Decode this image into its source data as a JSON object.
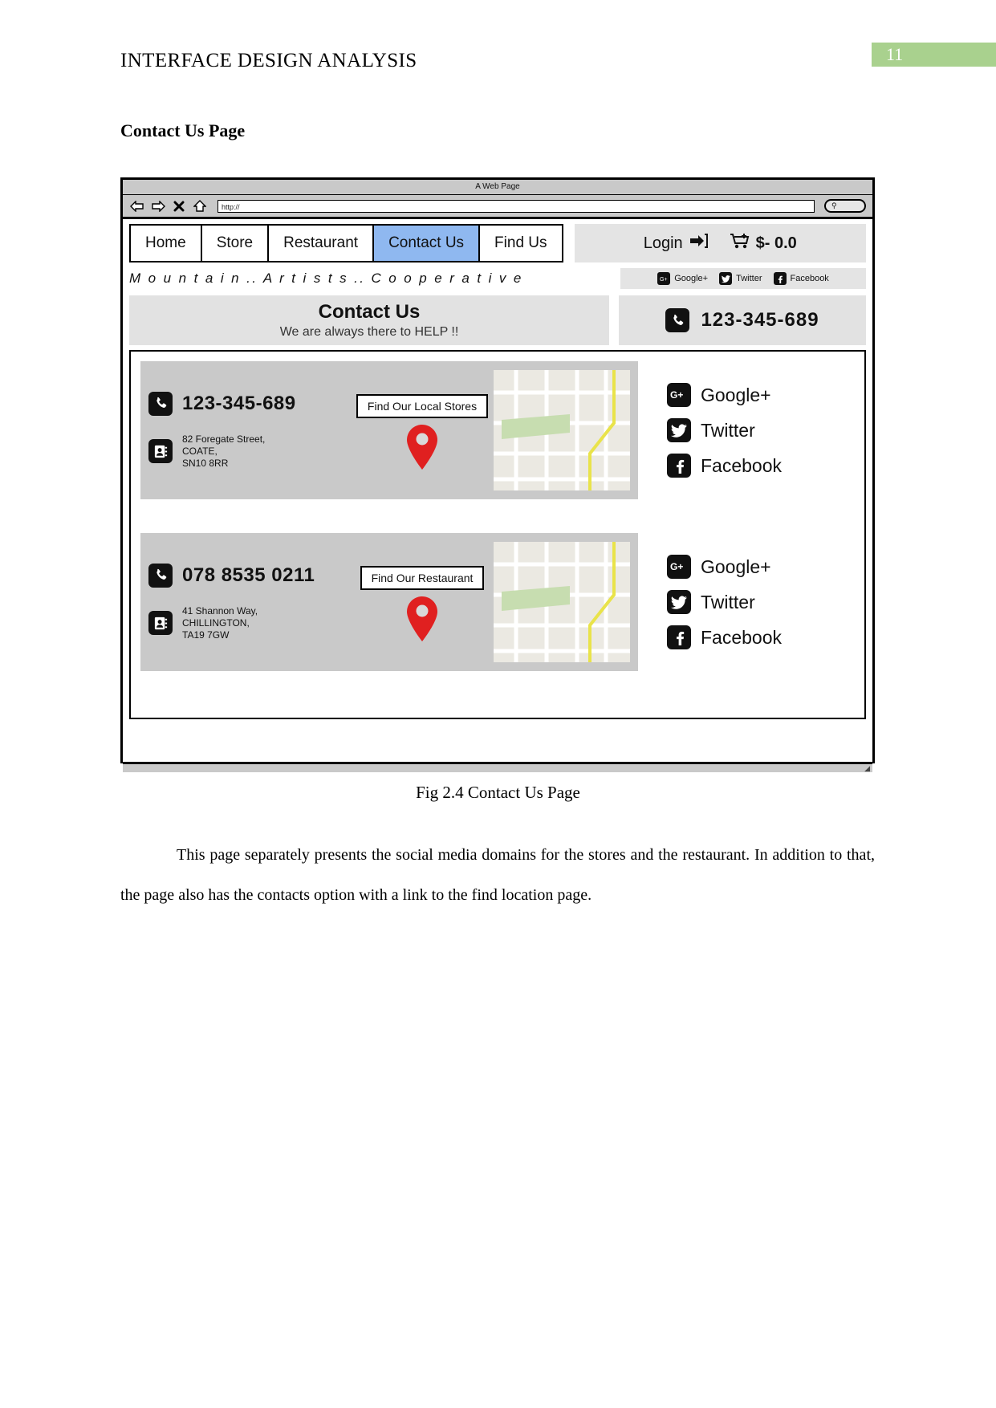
{
  "doc": {
    "header_title": "INTERFACE DESIGN ANALYSIS",
    "page_number": "11",
    "section_heading": "Contact Us Page",
    "figure_caption": "Fig 2.4 Contact Us Page",
    "paragraph": "This page separately presents the social media domains for the stores and the restaurant. In addition to that, the page also has the contacts option with a link to the find location page.",
    "accent_green": "#a9d18e"
  },
  "browser": {
    "window_title": "A Web Page",
    "address_value": "http://",
    "toolbar_icons": [
      "back-arrow-icon",
      "forward-arrow-icon",
      "stop-x-icon",
      "home-icon"
    ],
    "search_icon": "magnifier-icon"
  },
  "site": {
    "nav_tabs": [
      {
        "label": "Home",
        "active": false
      },
      {
        "label": "Store",
        "active": false
      },
      {
        "label": "Restaurant",
        "active": false
      },
      {
        "label": "Contact Us",
        "active": true
      },
      {
        "label": "Find Us",
        "active": false
      }
    ],
    "active_tab_color": "#8fb8f0",
    "login_label": "Login",
    "login_icon": "login-arrow-icon",
    "cart_icon": "shopping-cart-icon",
    "cart_total": "$- 0.0",
    "brand": "M o u n t a i n .. A r t i s t s .. C o o p e r a t i v e",
    "social_mini": [
      {
        "label": "Google+",
        "icon": "google-plus-icon"
      },
      {
        "label": "Twitter",
        "icon": "twitter-icon"
      },
      {
        "label": "Facebook",
        "icon": "facebook-icon"
      }
    ],
    "hero_title": "Contact Us",
    "hero_subtitle": "We are always there to HELP !!",
    "hero_phone": "123-345-689",
    "hero_phone_icon": "phone-icon"
  },
  "cards": [
    {
      "phone": "123-345-689",
      "phone_icon": "phone-icon",
      "address_icon": "contact-book-icon",
      "address": "82 Foregate Street,\nCOATE,\nSN10 8RR",
      "find_button": "Find Our Local Stores",
      "pin_icon": "map-pin-icon",
      "map_icon": "map-thumbnail",
      "social": [
        {
          "label": "Google+",
          "icon": "google-plus-icon"
        },
        {
          "label": "Twitter",
          "icon": "twitter-icon"
        },
        {
          "label": "Facebook",
          "icon": "facebook-icon"
        }
      ]
    },
    {
      "phone": "078 8535 0211",
      "phone_icon": "phone-icon",
      "address_icon": "contact-book-icon",
      "address": "41 Shannon Way,\nCHILLINGTON,\nTA19 7GW",
      "find_button": "Find Our Restaurant",
      "pin_icon": "map-pin-icon",
      "map_icon": "map-thumbnail",
      "social": [
        {
          "label": "Google+",
          "icon": "google-plus-icon"
        },
        {
          "label": "Twitter",
          "icon": "twitter-icon"
        },
        {
          "label": "Facebook",
          "icon": "facebook-icon"
        }
      ]
    }
  ]
}
